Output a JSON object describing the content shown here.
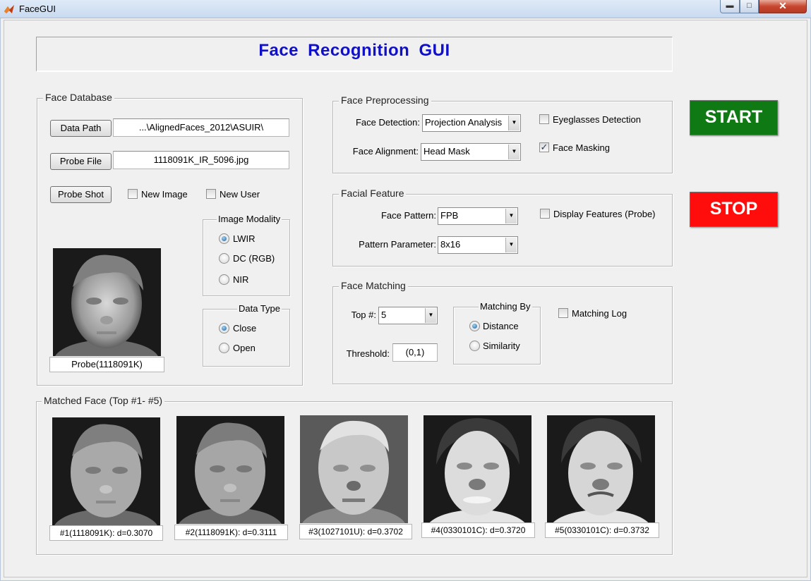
{
  "window": {
    "title": "FaceGUI"
  },
  "header": {
    "title": "Face  Recognition  GUI"
  },
  "face_database": {
    "title": "Face Database",
    "data_path_label": "Data Path",
    "data_path_value": "...\\AlignedFaces_2012\\ASUIR\\",
    "probe_file_label": "Probe File",
    "probe_file_value": "1118091K_IR_5096.jpg",
    "probe_shot_label": "Probe Shot",
    "new_image_label": "New Image",
    "new_user_label": "New User",
    "probe_caption": "Probe(1118091K)",
    "image_modality": {
      "title": "Image Modality",
      "options": [
        "LWIR",
        "DC (RGB)",
        "NIR"
      ],
      "selected": "LWIR"
    },
    "data_type": {
      "title": "Data Type",
      "options": [
        "Close",
        "Open"
      ],
      "selected": "Close"
    }
  },
  "preprocessing": {
    "title": "Face Preprocessing",
    "detection_label": "Face Detection:",
    "detection_value": "Projection Analysis",
    "alignment_label": "Face Alignment:",
    "alignment_value": "Head Mask",
    "eyeglasses_label": "Eyeglasses Detection",
    "eyeglasses_checked": false,
    "masking_label": "Face Masking",
    "masking_checked": true
  },
  "facial_feature": {
    "title": "Facial Feature",
    "pattern_label": "Face Pattern:",
    "pattern_value": "FPB",
    "parameter_label": "Pattern Parameter:",
    "parameter_value": "8x16",
    "display_label": "Display Features (Probe)",
    "display_checked": false
  },
  "matching": {
    "title": "Face Matching",
    "top_label": "Top #:",
    "top_value": "5",
    "threshold_label": "Threshold:",
    "threshold_value": "(0,1)",
    "matching_by": {
      "title": "Matching By",
      "options": [
        "Distance",
        "Similarity"
      ],
      "selected": "Distance"
    },
    "log_label": "Matching Log",
    "log_checked": false
  },
  "controls": {
    "start_label": "START",
    "stop_label": "STOP",
    "start_color": "#0f7a13",
    "stop_color": "#ff0c0c"
  },
  "matched": {
    "title": "Matched Face (Top #1- #5)",
    "faces": [
      {
        "caption": "#1(1118091K): d=0.3070"
      },
      {
        "caption": "#2(1118091K): d=0.3111"
      },
      {
        "caption": "#3(1027101U): d=0.3702"
      },
      {
        "caption": "#4(0330101C): d=0.3720"
      },
      {
        "caption": "#5(0330101C): d=0.3732"
      }
    ]
  },
  "icons": {
    "app": "matlab-icon",
    "minimize": "minimize-icon",
    "maximize": "maximize-icon",
    "close": "close-icon",
    "dropdown": "chevron-down-icon",
    "checkmark": "checkmark-icon"
  }
}
